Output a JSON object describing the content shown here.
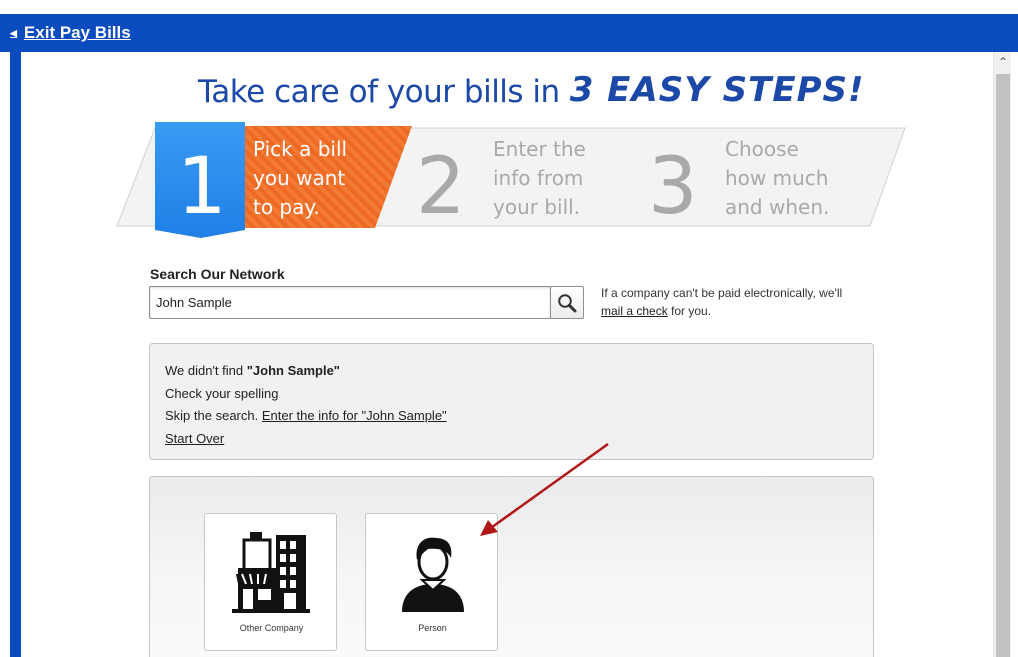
{
  "topbar": {
    "exit_label": "Exit Pay Bills",
    "color": "#0a4bbd"
  },
  "headline": {
    "main": "Take care of your bills in",
    "script": "3 easy steps!"
  },
  "steps": [
    {
      "number": "1",
      "lines": [
        "Pick a bill",
        "you want",
        "to pay."
      ],
      "active": true
    },
    {
      "number": "2",
      "lines": [
        "Enter the",
        "info from",
        "your bill."
      ],
      "active": false
    },
    {
      "number": "3",
      "lines": [
        "Choose",
        "how much",
        "and when."
      ],
      "active": false
    }
  ],
  "search": {
    "label": "Search Our Network",
    "value": "John Sample",
    "button_icon": "magnifier-icon"
  },
  "side_note": {
    "prefix": "If a company can't be paid electronically, we'll",
    "link": "mail a check",
    "suffix": " for you."
  },
  "not_found": {
    "prefix": "We didn't find ",
    "query": "\"John Sample\"",
    "spelling": "Check your spelling",
    "skip_prefix": "Skip the search. ",
    "skip_link": "Enter the info for \"John Sample\"",
    "start_over": "Start Over"
  },
  "payee_types": [
    {
      "label": "Other Company",
      "icon": "building-icon"
    },
    {
      "label": "Person",
      "icon": "person-icon"
    }
  ],
  "colors": {
    "accent_blue": "#1c48a8",
    "step_active_blue": "#2a8ef0",
    "step_active_orange": "#ee6a24",
    "step_inactive_gray": "#a9a9a9",
    "annotation_arrow": "#b01818"
  }
}
